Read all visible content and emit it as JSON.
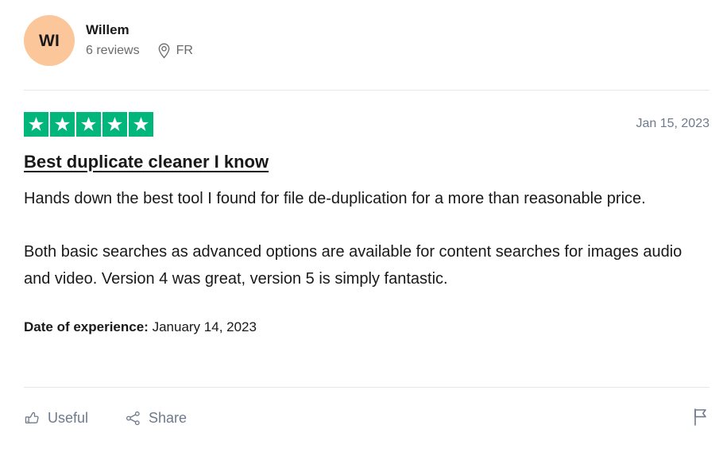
{
  "review": {
    "consumer": {
      "avatar_initials": "WI",
      "avatar_color": "#fbc79a",
      "name": "Willem",
      "review_count_label": "6 reviews",
      "location_icon": "map-pin-icon",
      "country_code": "FR"
    },
    "rating": {
      "stars": 5,
      "star_color": "#00b67a",
      "star_labels": [
        "star-1",
        "star-2",
        "star-3",
        "star-4",
        "star-5"
      ]
    },
    "date": "Jan 15, 2023",
    "title": "Best duplicate cleaner I know",
    "paragraphs": [
      "Hands down the best tool I found for file de-duplication for a more than reasonable price.",
      "Both basic searches as advanced options are available for content searches for images audio and video. Version 4 was great, version 5 is simply fantastic."
    ],
    "date_of_experience": {
      "label": "Date of experience:",
      "value": "January 14, 2023"
    },
    "actions": {
      "useful_label": "Useful",
      "useful_icon": "thumbs-up-icon",
      "share_label": "Share",
      "share_icon": "share-nodes-icon",
      "report_icon": "flag-icon"
    }
  }
}
